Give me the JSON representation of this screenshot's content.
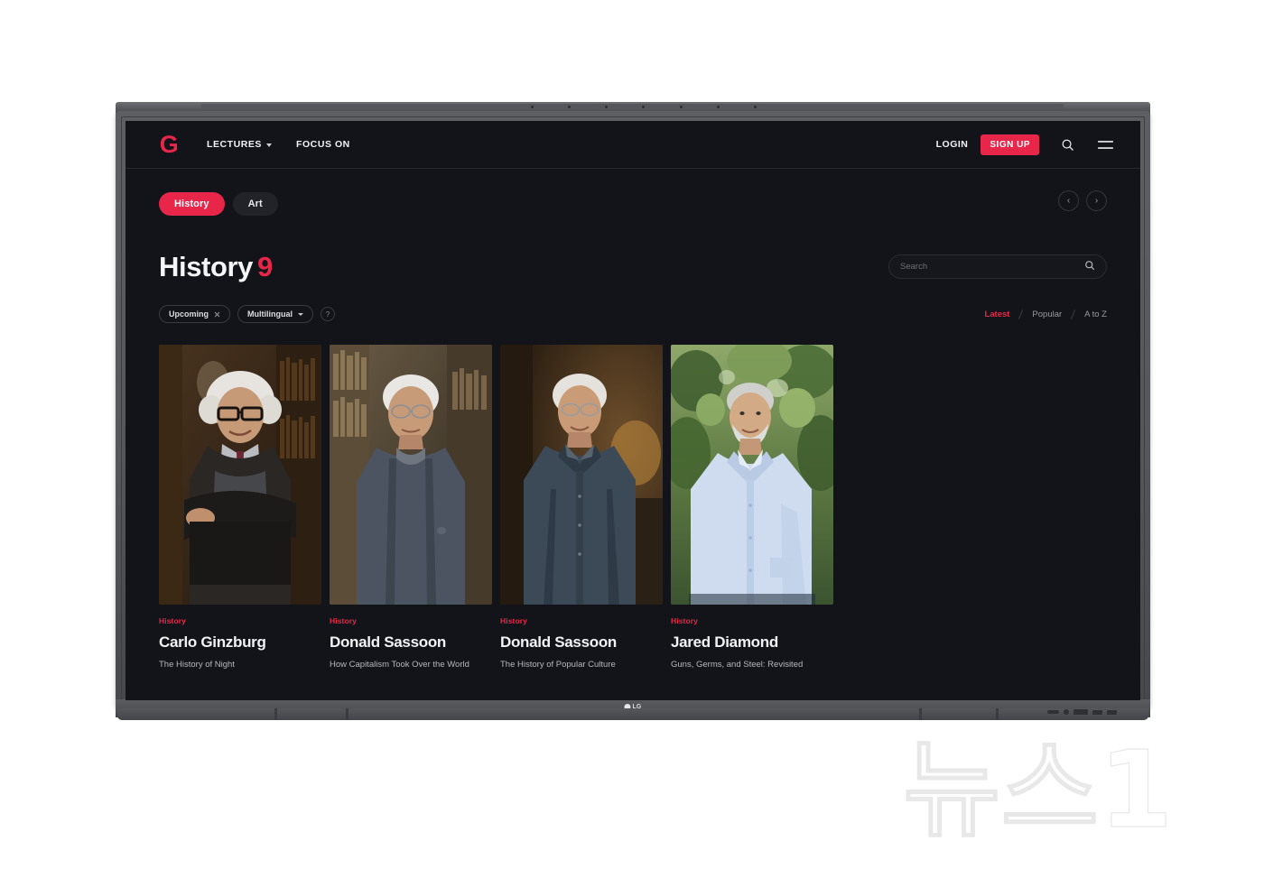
{
  "header": {
    "logo": "G",
    "nav": [
      {
        "label": "LECTURES",
        "has_chevron": true,
        "icon": "chevron-down-icon"
      },
      {
        "label": "FOCUS ON",
        "has_chevron": false
      }
    ],
    "login_label": "LOGIN",
    "signup_label": "SIGN UP",
    "search_icon": "search-icon",
    "menu_icon": "hamburger-menu-icon"
  },
  "categories": [
    {
      "label": "History",
      "active": true
    },
    {
      "label": "Art",
      "active": false
    }
  ],
  "carousel": {
    "prev_label": "‹",
    "next_label": "›",
    "prev_icon": "chevron-left-icon",
    "next_icon": "chevron-right-icon"
  },
  "page": {
    "title": "History",
    "count": "9"
  },
  "search": {
    "placeholder": "Search",
    "value": "",
    "icon": "search-icon"
  },
  "filters": [
    {
      "label": "Upcoming",
      "icon": "close-x-icon"
    },
    {
      "label": "Multilingual",
      "icon": "chevron-down-icon"
    }
  ],
  "help_label": "?",
  "sort": [
    {
      "label": "Latest",
      "active": true
    },
    {
      "label": "Popular",
      "active": false
    },
    {
      "label": "A to Z",
      "active": false
    }
  ],
  "cards": [
    {
      "tag": "History",
      "name": "Carlo Ginzburg",
      "subtitle": "The History of Night",
      "image_alt": "portrait-elderly-man-glasses-arms-crossed-library"
    },
    {
      "tag": "History",
      "name": "Donald Sassoon",
      "subtitle": "How Capitalism Took Over the World",
      "image_alt": "portrait-man-grey-sweater-bookshelves"
    },
    {
      "tag": "History",
      "name": "Donald Sassoon",
      "subtitle": "The History of Popular Culture",
      "image_alt": "portrait-man-blue-shirt-warm-interior"
    },
    {
      "tag": "History",
      "name": "Jared Diamond",
      "subtitle": "Guns, Germs, and Steel: Revisited",
      "image_alt": "portrait-man-light-blue-shirt-outdoors-trees"
    }
  ],
  "device": {
    "brand": "LG"
  },
  "watermark": {
    "text": "뉴스1"
  },
  "colors": {
    "accent": "#e8264a",
    "screen_bg": "#131419",
    "text_primary": "#f2f3f5",
    "text_muted": "#9a9ba1",
    "pill_idle": "#222328",
    "bezel": "#55575b"
  }
}
